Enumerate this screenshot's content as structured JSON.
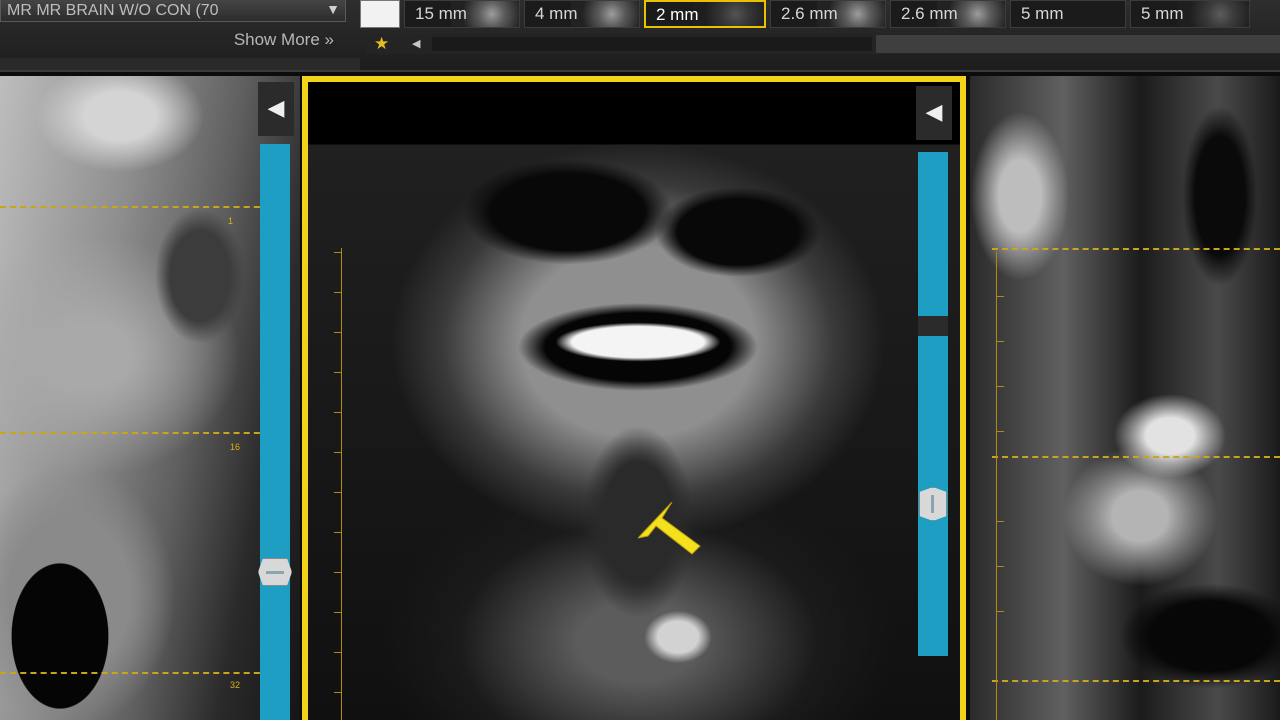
{
  "toolbar": {
    "series_description": "MR  MR BRAIN W/O CON (70",
    "series_dropdown_icon": "chevrons-down-icon",
    "show_more_label": "Show More",
    "show_more_icon": "double-chevron-down-icon",
    "thumbnails": [
      {
        "label": "",
        "selected": false,
        "blank": true
      },
      {
        "label": "15 mm",
        "selected": false
      },
      {
        "label": "4 mm",
        "selected": false
      },
      {
        "label": "2 mm",
        "selected": true
      },
      {
        "label": "2.6 mm",
        "selected": false
      },
      {
        "label": "2.6 mm",
        "selected": false
      },
      {
        "label": "5 mm",
        "selected": false
      },
      {
        "label": "5 mm",
        "selected": false
      }
    ],
    "favorite_icon": "star-icon",
    "scroll_left_icon": "caret-left-icon"
  },
  "viewports": {
    "left": {
      "collapse_icon": "caret-left-icon",
      "line_numbers": [
        "1",
        "16",
        "32"
      ]
    },
    "center": {
      "collapse_icon": "caret-left-icon",
      "active": true,
      "highlight_color": "#f2d31a"
    },
    "right": {}
  },
  "colors": {
    "accent": "#f2d31a",
    "slice_bar": "#1e9ec2",
    "reference_line": "#c9a519"
  }
}
